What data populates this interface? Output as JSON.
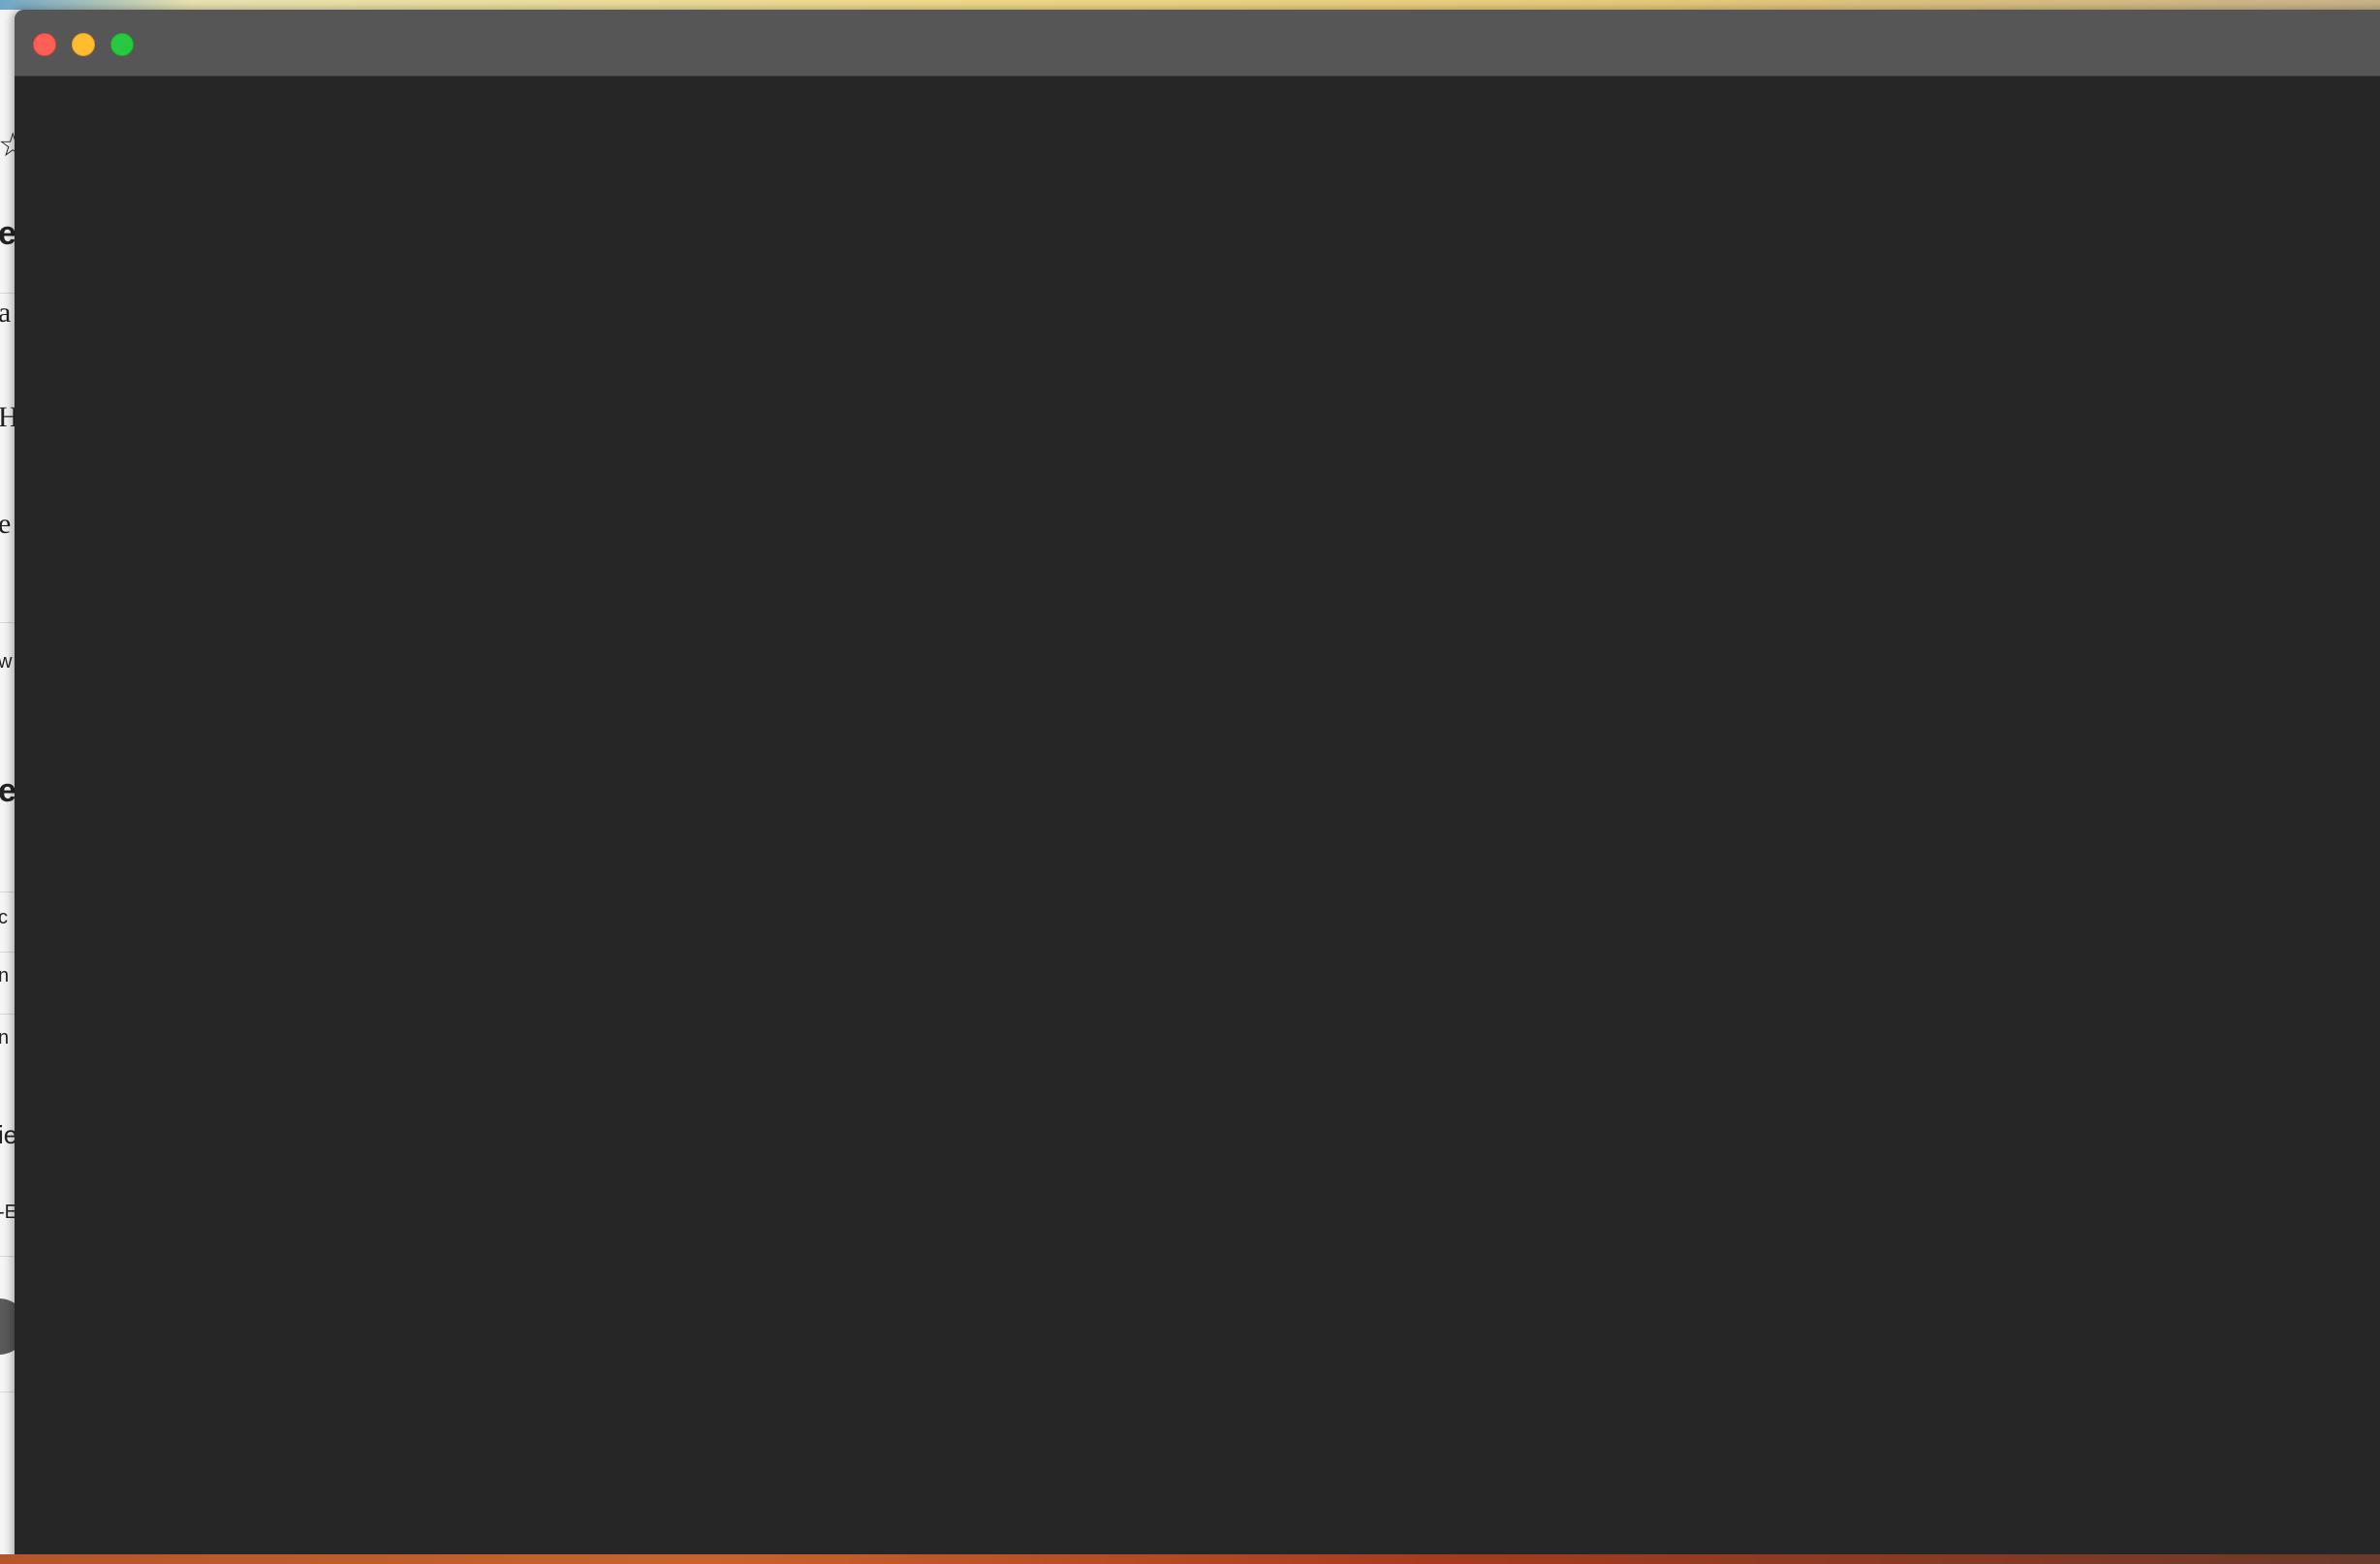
{
  "background_window": {
    "fragments": {
      "star": "☆",
      "title": "e",
      "line1": "a",
      "line2": "H",
      "line3": "e",
      "small1": "w",
      "heading2": "e",
      "cell1": "c",
      "cell2": "n",
      "cell3": "n",
      "item": "ie",
      "small2": "-E"
    }
  },
  "main_window": {
    "title": "",
    "controls": {
      "close": "close-window",
      "minimize": "minimize-window",
      "zoom": "zoom-window"
    },
    "colors": {
      "title_bar": "#565656",
      "content": "#262626",
      "close": "#fe5f57",
      "minimize": "#febc2e",
      "zoom": "#28c840"
    }
  }
}
